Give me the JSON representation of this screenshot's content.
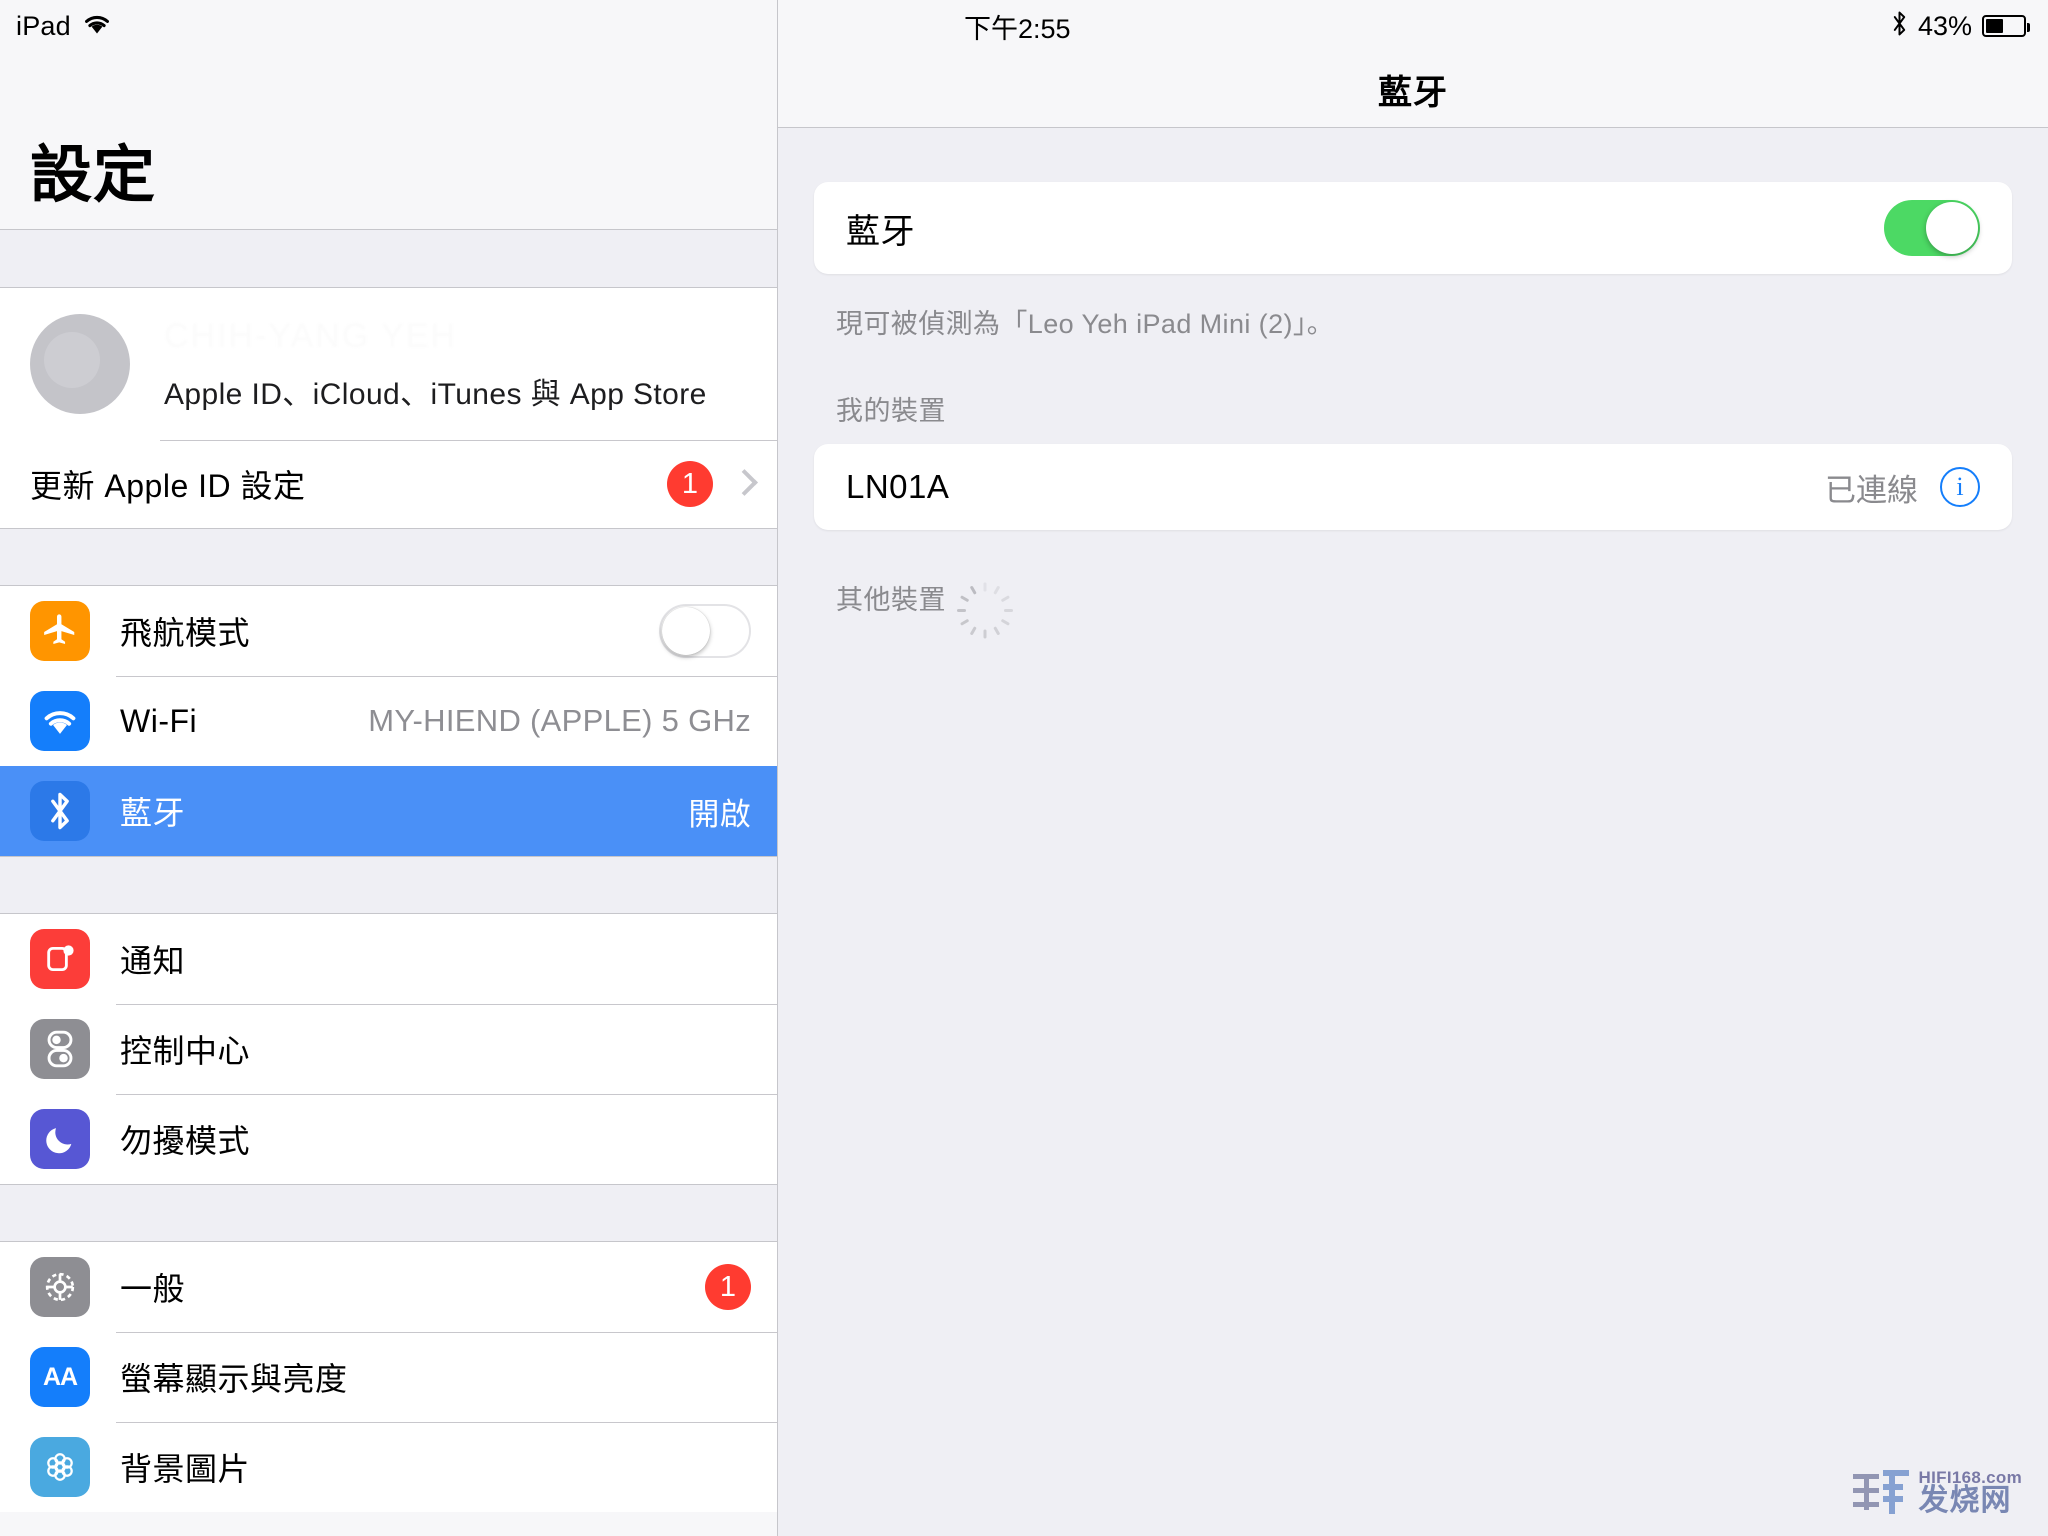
{
  "status_bar": {
    "device_label": "iPad",
    "wifi_icon": "wifi-icon",
    "time": "下午2:55",
    "bluetooth_icon": "bluetooth-icon",
    "battery_percent": "43%",
    "battery_icon": "battery-icon"
  },
  "sidebar": {
    "title": "設定",
    "apple_id": {
      "name": "CHIH-YANG YEH",
      "subtitle": "Apple ID、iCloud、iTunes 與 App Store",
      "avatar_icon": "avatar-placeholder-icon"
    },
    "update_row": {
      "label": "更新 Apple ID 設定",
      "badge": "1",
      "chevron_icon": "chevron-right-icon"
    },
    "groups": [
      {
        "items": [
          {
            "label": "飛航模式",
            "icon": "airplane-icon",
            "accessory": "toggle",
            "toggle_on": false
          },
          {
            "label": "Wi-Fi",
            "icon": "wifi-icon",
            "value": "MY-HIEND (APPLE) 5 GHz"
          },
          {
            "label": "藍牙",
            "icon": "bluetooth-icon",
            "value": "開啟",
            "selected": true
          }
        ]
      },
      {
        "items": [
          {
            "label": "通知",
            "icon": "notifications-icon"
          },
          {
            "label": "控制中心",
            "icon": "control-center-icon"
          },
          {
            "label": "勿擾模式",
            "icon": "do-not-disturb-icon"
          }
        ]
      },
      {
        "items": [
          {
            "label": "一般",
            "icon": "gear-icon",
            "badge": "1"
          },
          {
            "label": "螢幕顯示與亮度",
            "icon": "display-brightness-icon"
          },
          {
            "label": "背景圖片",
            "icon": "wallpaper-icon"
          }
        ]
      }
    ]
  },
  "main": {
    "nav_title": "藍牙",
    "bluetooth_toggle": {
      "label": "藍牙",
      "on": true
    },
    "discoverable_note": "現可被偵測為「Leo Yeh iPad Mini (2)」。",
    "my_devices_header": "我的裝置",
    "devices": [
      {
        "name": "LN01A",
        "status": "已連線",
        "info_icon": "info-icon"
      }
    ],
    "other_devices_header": "其他裝置",
    "scanning_icon": "activity-spinner-icon"
  },
  "watermark": {
    "top": "HIFI168.com",
    "bottom": "发烧网"
  },
  "colors": {
    "selection_blue": "#4a90f7",
    "toggle_green": "#4cd964",
    "badge_red": "#ff3b30",
    "tint_blue": "#147efb"
  }
}
